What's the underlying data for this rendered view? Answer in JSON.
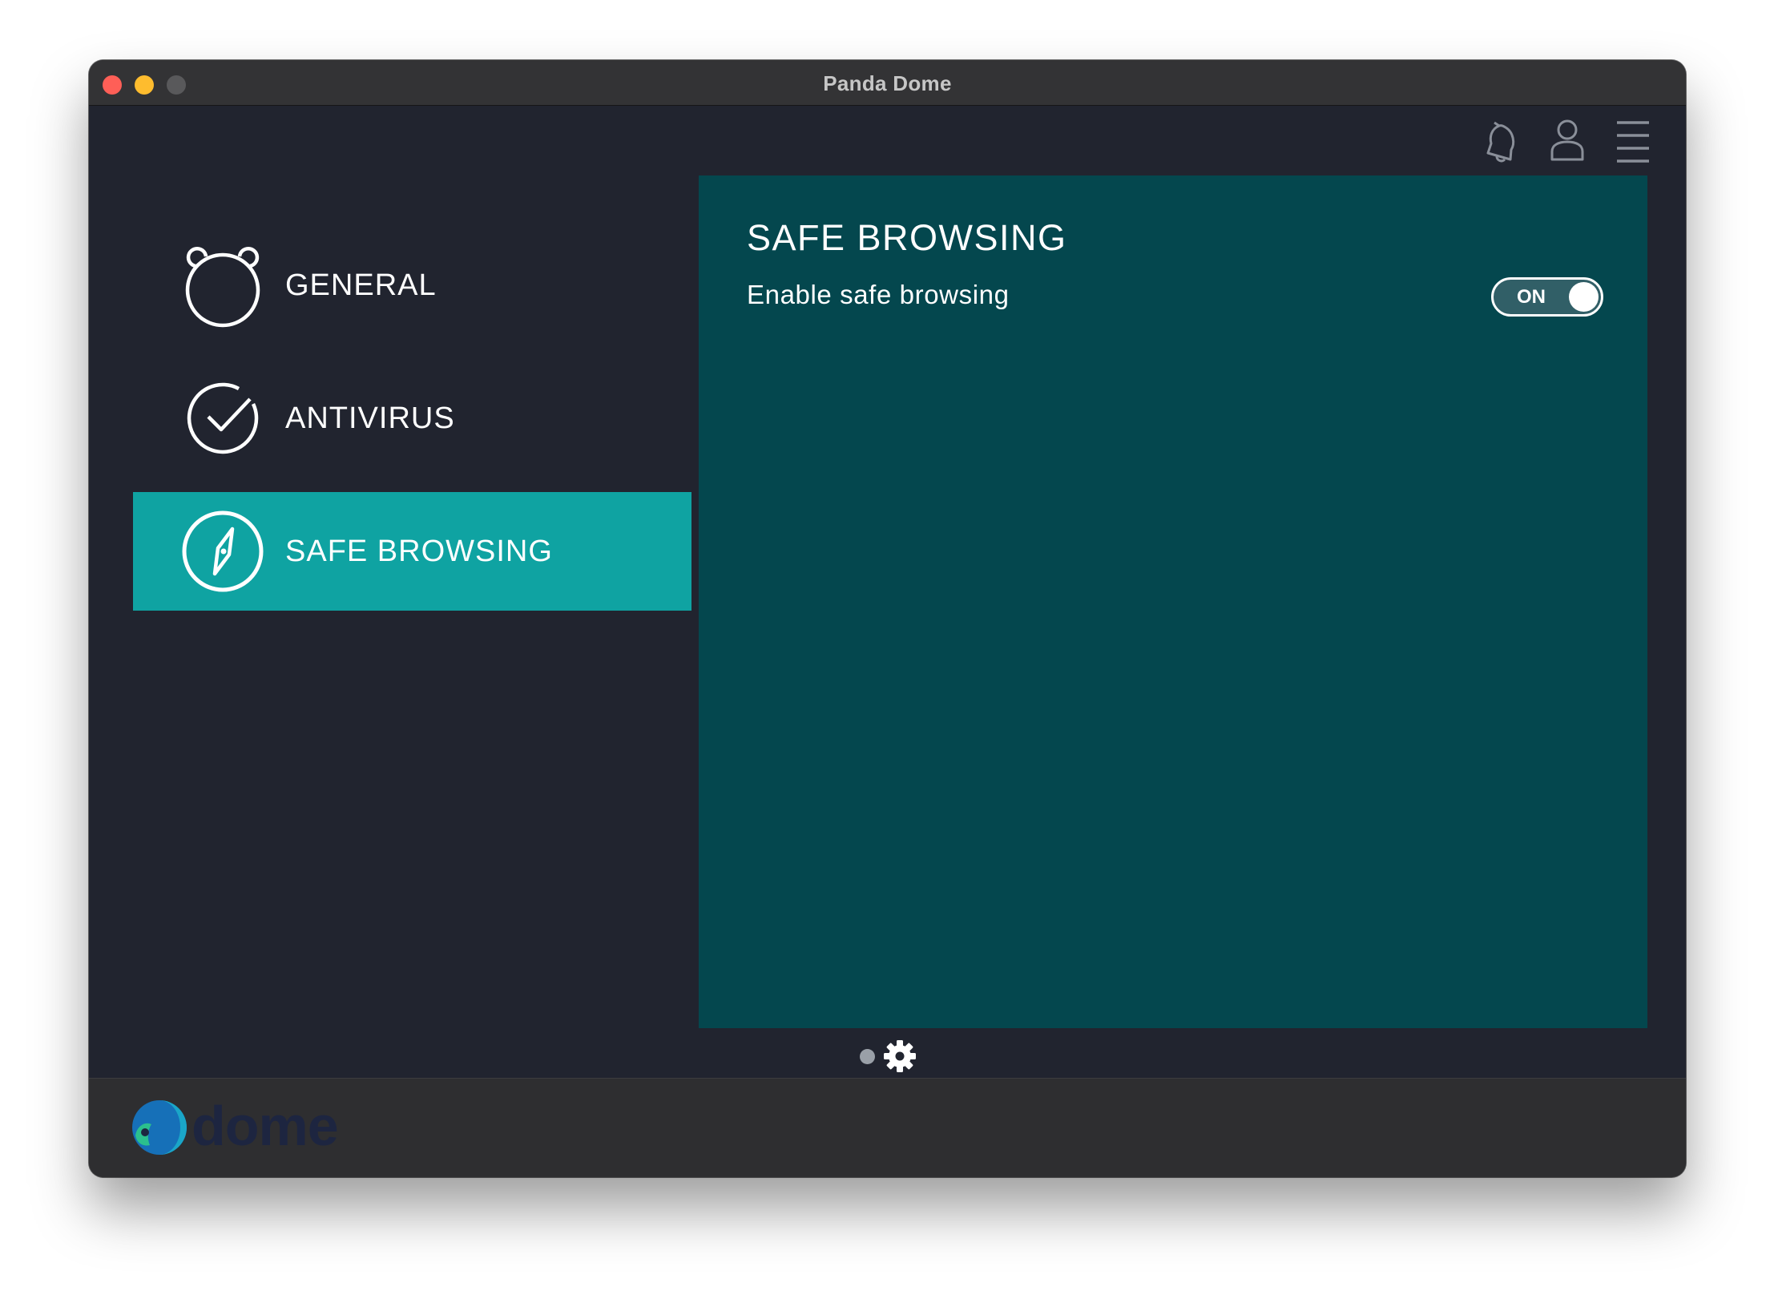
{
  "window": {
    "title": "Panda Dome"
  },
  "header": {
    "icons": [
      "bell-icon",
      "user-icon",
      "hamburger-menu-icon"
    ]
  },
  "sidebar": {
    "items": [
      {
        "label": "GENERAL",
        "icon": "panda-face-icon",
        "active": false
      },
      {
        "label": "ANTIVIRUS",
        "icon": "check-circle-icon",
        "active": false
      },
      {
        "label": "SAFE BROWSING",
        "icon": "compass-icon",
        "active": true
      }
    ]
  },
  "main": {
    "section_title": "SAFE BROWSING",
    "settings": [
      {
        "label": "Enable safe browsing",
        "toggle_text": "ON",
        "enabled": true
      }
    ]
  },
  "pager": {
    "icons": [
      "page-dot",
      "gear-icon"
    ]
  },
  "footer": {
    "logo_text": "dome"
  },
  "colors": {
    "content_bg": "#04474e",
    "sidebar_bg": "#21242f",
    "active_item": "#0fa3a2",
    "footer_bg": "#2e2e30"
  }
}
